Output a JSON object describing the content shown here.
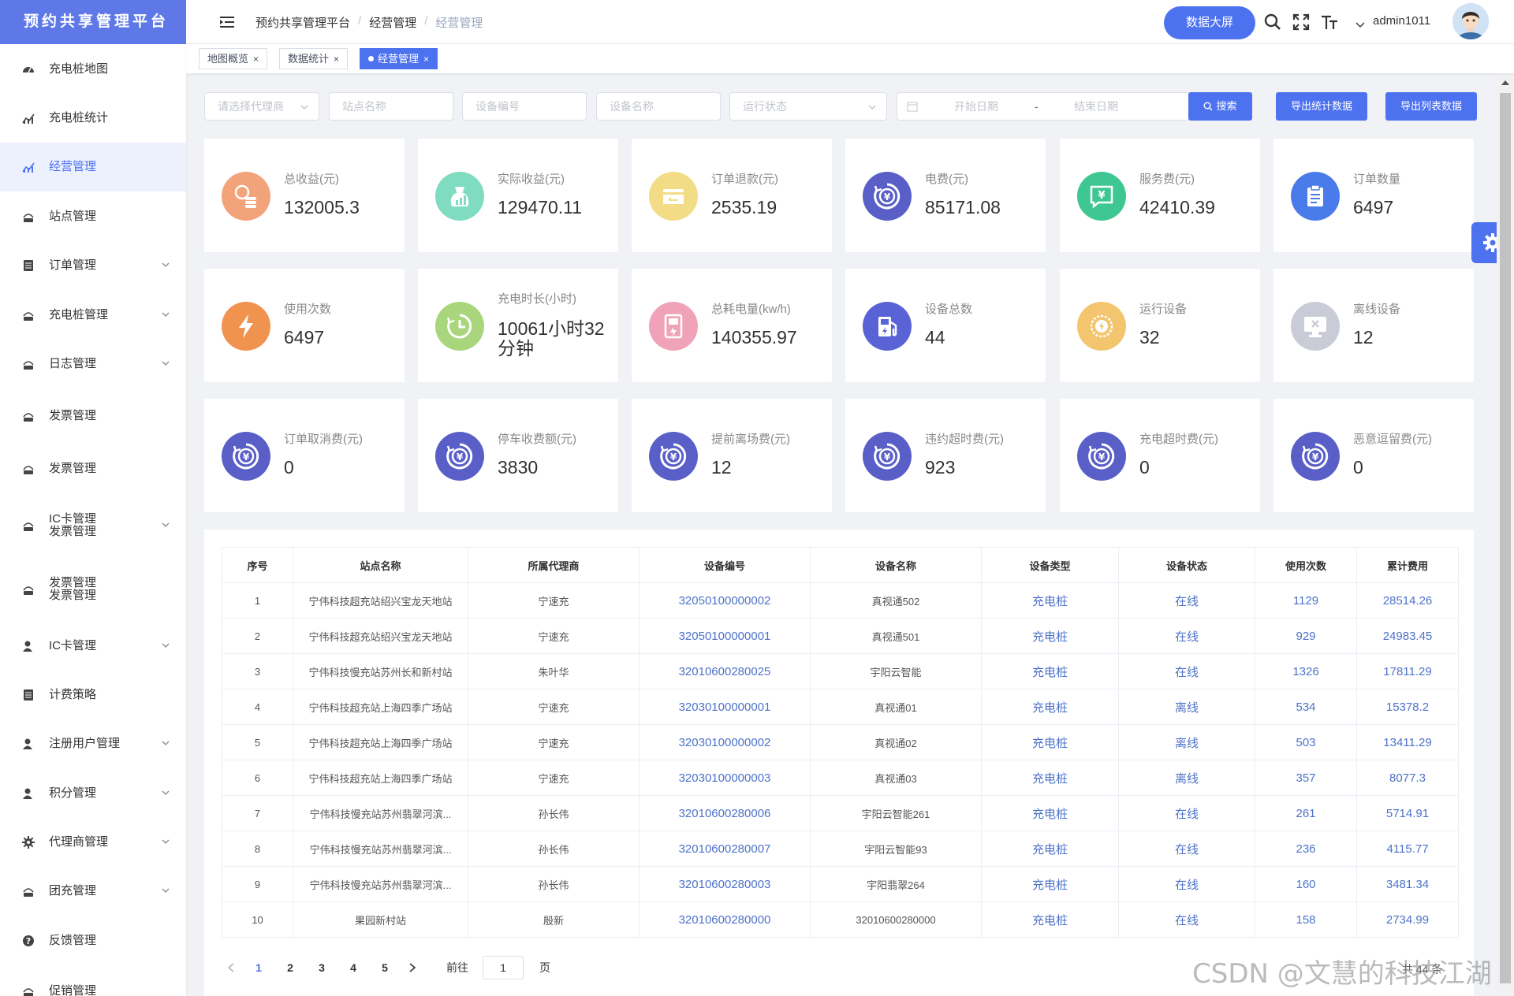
{
  "app": {
    "title": "预约共享管理平台"
  },
  "sidebar": {
    "items": [
      {
        "label": "充电桩地图",
        "icon": "dashboard-icon",
        "expandable": false,
        "active": false
      },
      {
        "label": "充电桩统计",
        "icon": "chart-icon",
        "expandable": false,
        "active": false
      },
      {
        "label": "经营管理",
        "icon": "chart-icon",
        "expandable": false,
        "active": true
      },
      {
        "label": "站点管理",
        "icon": "station-icon",
        "expandable": false,
        "active": false
      },
      {
        "label": "订单管理",
        "icon": "list-icon",
        "expandable": true,
        "active": false
      },
      {
        "label": "充电桩管理",
        "icon": "station-icon",
        "expandable": true,
        "active": false
      },
      {
        "label": "日志管理",
        "icon": "station-icon",
        "expandable": true,
        "active": false
      },
      {
        "label": "发票管理",
        "icon": "station-icon",
        "expandable": false,
        "active": false
      },
      {
        "label": "发票管理",
        "icon": "station-icon",
        "expandable": false,
        "active": false
      },
      {
        "label": "IC卡管理",
        "label2": "发票管理",
        "icon": "station-icon",
        "expandable": true,
        "active": false
      },
      {
        "label": "发票管理",
        "label2": "发票管理",
        "icon": "station-icon",
        "expandable": false,
        "active": false
      },
      {
        "label": "IC卡管理",
        "icon": "user-icon",
        "expandable": true,
        "active": false
      },
      {
        "label": "计费策略",
        "icon": "list-icon",
        "expandable": false,
        "active": false
      },
      {
        "label": "注册用户管理",
        "icon": "user-icon",
        "expandable": true,
        "active": false
      },
      {
        "label": "积分管理",
        "icon": "user-icon",
        "expandable": true,
        "active": false
      },
      {
        "label": "代理商管理",
        "icon": "gear-icon",
        "expandable": true,
        "active": false
      },
      {
        "label": "团充管理",
        "icon": "station-icon",
        "expandable": true,
        "active": false
      },
      {
        "label": "反馈管理",
        "icon": "question-icon",
        "expandable": false,
        "active": false
      },
      {
        "label": "促销管理",
        "icon": "station-icon",
        "expandable": false,
        "active": false
      }
    ]
  },
  "header": {
    "breadcrumb": [
      "预约共享管理平台",
      "经营管理",
      "经营管理"
    ],
    "big_screen_label": "数据大屏",
    "user_name": "admin1011"
  },
  "tags": [
    {
      "label": "地图概览",
      "active": false
    },
    {
      "label": "数据统计",
      "active": false
    },
    {
      "label": "经营管理",
      "active": true
    }
  ],
  "filters": {
    "agent_placeholder": "请选择代理商",
    "station_placeholder": "站点名称",
    "device_no_placeholder": "设备编号",
    "device_name_placeholder": "设备名称",
    "status_placeholder": "运行状态",
    "start_date_placeholder": "开始日期",
    "date_sep": "-",
    "end_date_placeholder": "结束日期",
    "search_label": "搜索",
    "export_stats_label": "导出统计数据",
    "export_list_label": "导出列表数据"
  },
  "stats": [
    {
      "label": "总收益(元)",
      "value": "132005.3",
      "icon": "coins-icon",
      "color": "#f3a37a"
    },
    {
      "label": "实际收益(元)",
      "value": "129470.11",
      "icon": "bag-chart-icon",
      "color": "#7fdcc0"
    },
    {
      "label": "订单退款(元)",
      "value": "2535.19",
      "icon": "refund-card-icon",
      "color": "#f2dc86"
    },
    {
      "label": "电费(元)",
      "value": "85171.08",
      "icon": "yen-coin-icon",
      "color": "#5a5fc8"
    },
    {
      "label": "服务费(元)",
      "value": "42410.39",
      "icon": "yen-chat-icon",
      "color": "#3ec792"
    },
    {
      "label": "订单数量",
      "value": "6497",
      "icon": "clipboard-icon",
      "color": "#4a7bea"
    },
    {
      "label": "使用次数",
      "value": "6497",
      "icon": "lightning-icon",
      "color": "#f0934e"
    },
    {
      "label": "充电时长(小时)",
      "value": "10061小时32分钟",
      "icon": "clock-icon",
      "color": "#a9d67c"
    },
    {
      "label": "总耗电量(kw/h)",
      "value": "140355.97",
      "icon": "meter-icon",
      "color": "#f0a3b8"
    },
    {
      "label": "设备总数",
      "value": "44",
      "icon": "fuel-icon",
      "color": "#5a63d6"
    },
    {
      "label": "运行设备",
      "value": "32",
      "icon": "gauge-icon",
      "color": "#f2c56e"
    },
    {
      "label": "离线设备",
      "value": "12",
      "icon": "monitor-x-icon",
      "color": "#c9ccd6"
    },
    {
      "label": "订单取消费(元)",
      "value": "0",
      "icon": "yen-coin-icon",
      "color": "#5a5fc8"
    },
    {
      "label": "停车收费额(元)",
      "value": "3830",
      "icon": "yen-coin-icon",
      "color": "#5a5fc8"
    },
    {
      "label": "提前离场费(元)",
      "value": "12",
      "icon": "yen-coin-icon",
      "color": "#5a5fc8"
    },
    {
      "label": "违约超时费(元)",
      "value": "923",
      "icon": "yen-coin-icon",
      "color": "#5a5fc8"
    },
    {
      "label": "充电超时费(元)",
      "value": "0",
      "icon": "yen-coin-icon",
      "color": "#5a5fc8"
    },
    {
      "label": "恶意逗留费(元)",
      "value": "0",
      "icon": "yen-coin-icon",
      "color": "#5a5fc8"
    }
  ],
  "table": {
    "columns": [
      "序号",
      "站点名称",
      "所属代理商",
      "设备编号",
      "设备名称",
      "设备类型",
      "设备状态",
      "使用次数",
      "累计费用"
    ],
    "rows": [
      [
        "1",
        "宁伟科技超充站绍兴宝龙天地站",
        "宁速充",
        "32050100000002",
        "真视通502",
        "充电桩",
        "在线",
        "1129",
        "28514.26"
      ],
      [
        "2",
        "宁伟科技超充站绍兴宝龙天地站",
        "宁速充",
        "32050100000001",
        "真视通501",
        "充电桩",
        "在线",
        "929",
        "24983.45"
      ],
      [
        "3",
        "宁伟科技慢充站苏州长和新村站",
        "朱叶华",
        "32010600280025",
        "宇阳云智能",
        "充电桩",
        "在线",
        "1326",
        "17811.29"
      ],
      [
        "4",
        "宁伟科技超充站上海四季广场站",
        "宁速充",
        "32030100000001",
        "真视通01",
        "充电桩",
        "离线",
        "534",
        "15378.2"
      ],
      [
        "5",
        "宁伟科技超充站上海四季广场站",
        "宁速充",
        "32030100000002",
        "真视通02",
        "充电桩",
        "离线",
        "503",
        "13411.29"
      ],
      [
        "6",
        "宁伟科技超充站上海四季广场站",
        "宁速充",
        "32030100000003",
        "真视通03",
        "充电桩",
        "离线",
        "357",
        "8077.3"
      ],
      [
        "7",
        "宁伟科技慢充站苏州翡翠河滨...",
        "孙长伟",
        "32010600280006",
        "宇阳云智能261",
        "充电桩",
        "在线",
        "261",
        "5714.91"
      ],
      [
        "8",
        "宁伟科技慢充站苏州翡翠河滨...",
        "孙长伟",
        "32010600280007",
        "宇阳云智能93",
        "充电桩",
        "在线",
        "236",
        "4115.77"
      ],
      [
        "9",
        "宁伟科技慢充站苏州翡翠河滨...",
        "孙长伟",
        "32010600280003",
        "宇阳翡翠264",
        "充电桩",
        "在线",
        "160",
        "3481.34"
      ],
      [
        "10",
        "果园新村站",
        "殷新",
        "32010600280000",
        "32010600280000",
        "充电桩",
        "在线",
        "158",
        "2734.99"
      ]
    ]
  },
  "pagination": {
    "pages": [
      "1",
      "2",
      "3",
      "4",
      "5"
    ],
    "current": "1",
    "goto_label": "前往",
    "goto_value": "1",
    "page_suffix": "页",
    "total_text": "共 44 条"
  },
  "watermark": "CSDN @文慧的科技江湖",
  "colors": {
    "accent": "#4d72f0",
    "link": "#4d72c8",
    "sidebar_active_bg": "#edf1fe"
  }
}
